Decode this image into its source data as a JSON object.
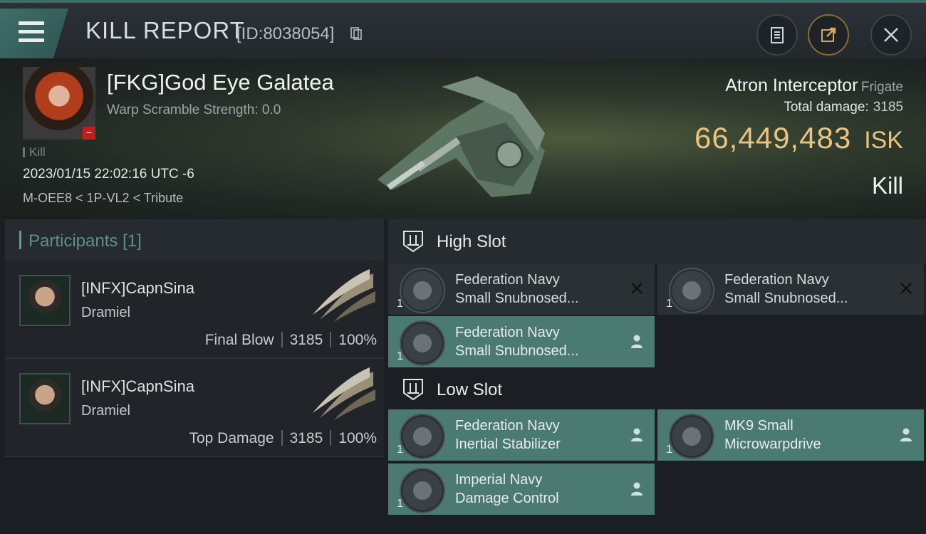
{
  "header": {
    "title": "KILL REPORT",
    "report_id": "[ID:8038054]"
  },
  "victim": {
    "name": "[FKG]God Eye Galatea",
    "warp_scramble": "Warp Scramble Strength: 0.0",
    "tag": "Kill",
    "datetime": "2023/01/15 22:02:16 UTC -6",
    "location": "M-OEE8 < 1P-VL2 < Tribute",
    "ship_name": "Atron Interceptor",
    "ship_class": "Frigate",
    "total_damage_label": "Total damage:",
    "total_damage": "3185",
    "isk_value": "66,449,483",
    "isk_unit": "ISK",
    "result": "Kill"
  },
  "participants": {
    "title": "Participants",
    "count": "[1]",
    "rows": [
      {
        "name": "[INFX]CapnSina",
        "corp": "Dramiel",
        "role": "Final Blow",
        "damage": "3185",
        "percent": "100%"
      },
      {
        "name": "[INFX]CapnSina",
        "corp": "Dramiel",
        "role": "Top Damage",
        "damage": "3185",
        "percent": "100%"
      }
    ]
  },
  "fittings": {
    "high_slot": {
      "title": "High Slot",
      "modules": [
        {
          "line1": "Federation Navy",
          "line2": "Small Snubnosed...",
          "qty": "1",
          "state": "destroyed"
        },
        {
          "line1": "Federation Navy",
          "line2": "Small Snubnosed...",
          "qty": "1",
          "state": "destroyed"
        },
        {
          "line1": "Federation Navy",
          "line2": "Small Snubnosed...",
          "qty": "1",
          "state": "dropped"
        }
      ]
    },
    "low_slot": {
      "title": "Low Slot",
      "modules": [
        {
          "line1": "Federation Navy",
          "line2": "Inertial Stabilizer",
          "qty": "1",
          "state": "dropped"
        },
        {
          "line1": "MK9 Small",
          "line2": "Microwarpdrive",
          "qty": "1",
          "state": "dropped"
        },
        {
          "line1": "Imperial Navy",
          "line2": "Damage Control",
          "qty": "1",
          "state": "dropped"
        }
      ]
    }
  },
  "colors": {
    "accent_teal": "#4b7a73",
    "isk_gold": "#e9c37f",
    "badge_red": "#c21e1e"
  },
  "icons": [
    "menu-icon",
    "copy-icon",
    "clipboard-icon",
    "share-icon",
    "close-icon",
    "slot-icon",
    "close-x-icon",
    "person-icon"
  ]
}
